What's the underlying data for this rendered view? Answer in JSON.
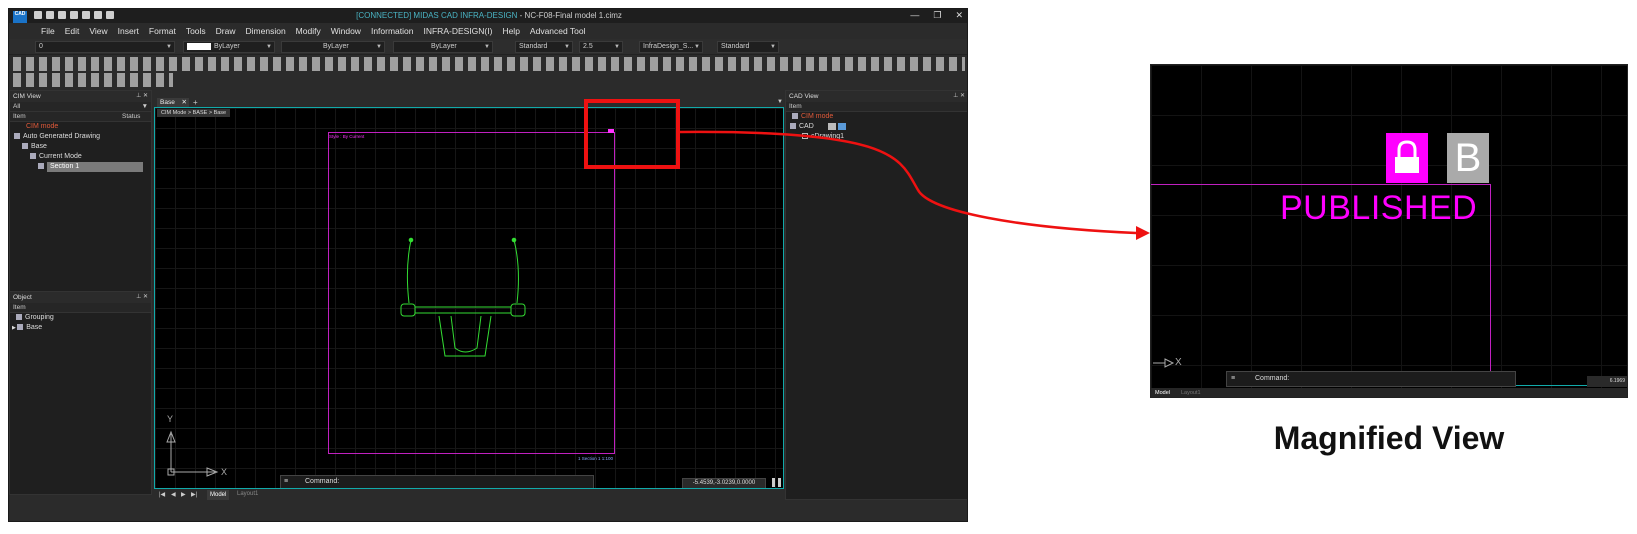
{
  "window": {
    "logo_text": "CAD",
    "status_prefix": "[CONNECTED] MIDAS CAD INFRA-DESIGN",
    "file_suffix": " - NC-F08-Final model 1.cimz",
    "min": "—",
    "max": "❐",
    "close": "✕"
  },
  "menu": [
    "File",
    "Edit",
    "View",
    "Insert",
    "Format",
    "Tools",
    "Draw",
    "Dimension",
    "Modify",
    "Window",
    "Information",
    "INFRA-DESIGN(I)",
    "Help",
    "Advanced Tool"
  ],
  "props": {
    "layer": "0",
    "color": "ByLayer",
    "linetype": "ByLayer",
    "lineweight": "ByLayer",
    "text_style": "Standard",
    "text_height": "2.5",
    "dim_style": "InfraDesign_S...",
    "table_style": "Standard"
  },
  "cim_view": {
    "title": "CIM View",
    "filter": "All",
    "col_item": "Item",
    "col_status": "Status",
    "rows": [
      "CIM mode",
      "Auto Generated Drawing",
      "Base",
      "Current Mode",
      "Section 1"
    ]
  },
  "object_panel": {
    "title": "Object",
    "col_item": "Item",
    "rows": [
      "Grouping",
      "Base"
    ]
  },
  "cad_view": {
    "title": "CAD View",
    "col_item": "Item",
    "rows": [
      "CIM mode",
      "CAD",
      "cDrawing1"
    ]
  },
  "doc": {
    "tab": "Base",
    "breadcrumb": "CIM Mode > BASE > Base",
    "style_label": "Style : By Current",
    "sheet_caption": "1 Section 1 1:100",
    "command_label": "Command:",
    "coords": "-5.4539,-3.0239,0.0000",
    "axis_x": "X",
    "axis_y": "Y",
    "tab_model": "Model",
    "tab_layout": "Layout1"
  },
  "magnified": {
    "badge_b": "B",
    "published": "PUBLISHED",
    "command_label": "Command:",
    "coords": "6.1969",
    "axis_x": "X",
    "tab_model": "Model",
    "tab_layout": "Layout1",
    "caption": "Magnified View"
  },
  "colors": {
    "highlight": "#ee1111",
    "published": "#ff00ff",
    "drawing": "#33dd33",
    "sheet_border": "#c020c0"
  }
}
